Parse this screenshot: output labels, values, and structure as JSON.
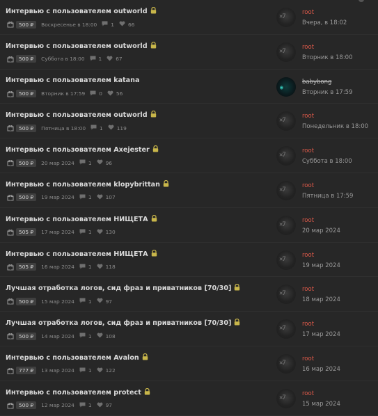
{
  "colors": {
    "background": "#272727",
    "username": "#e05a4a",
    "lock": "#c8b64a",
    "price_bg": "#3f3f3f"
  },
  "icons": {
    "lock": "lock-icon",
    "gift": "gift-icon",
    "comment": "comment-icon",
    "like": "heart-icon"
  },
  "threads": [
    {
      "title": "Интервью с пользователем outworld",
      "locked": true,
      "price": "500 ₽",
      "date": "Воскресенье в 18:00",
      "comments": "1",
      "likes": "66",
      "user": "root",
      "last_date": "Вчера, в 18:02",
      "banned": false
    },
    {
      "title": "Интервью с пользователем outworld",
      "locked": true,
      "price": "500 ₽",
      "date": "Суббота в 18:00",
      "comments": "1",
      "likes": "67",
      "user": "root",
      "last_date": "Вторник в 18:00",
      "banned": false
    },
    {
      "title": "Интервью с пользователем katana",
      "locked": false,
      "price": "500 ₽",
      "date": "Вторник в 17:59",
      "comments": "0",
      "likes": "56",
      "user": "babybong",
      "last_date": "Вторник в 17:59",
      "banned": true
    },
    {
      "title": "Интервью с пользователем outworld",
      "locked": true,
      "price": "500 ₽",
      "date": "Пятница в 18:00",
      "comments": "1",
      "likes": "119",
      "user": "root",
      "last_date": "Понедельник в 18:00",
      "banned": false
    },
    {
      "title": "Интервью с пользователем Axejester",
      "locked": true,
      "price": "500 ₽",
      "date": "20 мар 2024",
      "comments": "1",
      "likes": "96",
      "user": "root",
      "last_date": "Суббота в 18:00",
      "banned": false
    },
    {
      "title": "Интервью с пользователем klopybrittan",
      "locked": true,
      "price": "500 ₽",
      "date": "19 мар 2024",
      "comments": "1",
      "likes": "107",
      "user": "root",
      "last_date": "Пятница в 17:59",
      "banned": false
    },
    {
      "title": "Интервью с пользователем НИЩЕТА",
      "locked": true,
      "price": "505 ₽",
      "date": "17 мар 2024",
      "comments": "1",
      "likes": "130",
      "user": "root",
      "last_date": "20 мар 2024",
      "banned": false
    },
    {
      "title": "Интервью с пользователем НИЩЕТА",
      "locked": true,
      "price": "505 ₽",
      "date": "16 мар 2024",
      "comments": "1",
      "likes": "118",
      "user": "root",
      "last_date": "19 мар 2024",
      "banned": false
    },
    {
      "title": "Лучшая отработка логов, сид фраз и приватников [70/30]",
      "locked": true,
      "price": "500 ₽",
      "date": "15 мар 2024",
      "comments": "1",
      "likes": "97",
      "user": "root",
      "last_date": "18 мар 2024",
      "banned": false
    },
    {
      "title": "Лучшая отработка логов, сид фраз и приватников [70/30]",
      "locked": true,
      "price": "500 ₽",
      "date": "14 мар 2024",
      "comments": "1",
      "likes": "108",
      "user": "root",
      "last_date": "17 мар 2024",
      "banned": false
    },
    {
      "title": "Интервью с пользователем Avalon",
      "locked": true,
      "price": "777 ₽",
      "date": "13 мар 2024",
      "comments": "1",
      "likes": "122",
      "user": "root",
      "last_date": "16 мар 2024",
      "banned": false
    },
    {
      "title": "Интервью с пользователем protect",
      "locked": true,
      "price": "500 ₽",
      "date": "12 мар 2024",
      "comments": "1",
      "likes": "97",
      "user": "root",
      "last_date": "15 мар 2024",
      "banned": false
    }
  ]
}
